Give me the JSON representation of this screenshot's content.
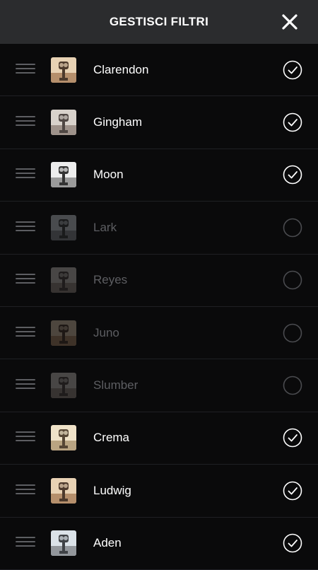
{
  "header": {
    "title": "GESTISCI FILTRI",
    "close_icon": "close-icon"
  },
  "filters": [
    {
      "name": "Clarendon",
      "enabled": true,
      "tint": "warm"
    },
    {
      "name": "Gingham",
      "enabled": true,
      "tint": "faded"
    },
    {
      "name": "Moon",
      "enabled": true,
      "tint": "mono"
    },
    {
      "name": "Lark",
      "enabled": false,
      "tint": "cool"
    },
    {
      "name": "Reyes",
      "enabled": false,
      "tint": "faded"
    },
    {
      "name": "Juno",
      "enabled": false,
      "tint": "warm"
    },
    {
      "name": "Slumber",
      "enabled": false,
      "tint": "faded"
    },
    {
      "name": "Crema",
      "enabled": true,
      "tint": "cream"
    },
    {
      "name": "Ludwig",
      "enabled": true,
      "tint": "warm"
    },
    {
      "name": "Aden",
      "enabled": true,
      "tint": "cool"
    }
  ],
  "colors": {
    "background": "#0a0a0b",
    "header": "#2b2c2e",
    "text_enabled": "#ffffff",
    "text_disabled": "#5d5e62",
    "divider": "#1f2024"
  }
}
